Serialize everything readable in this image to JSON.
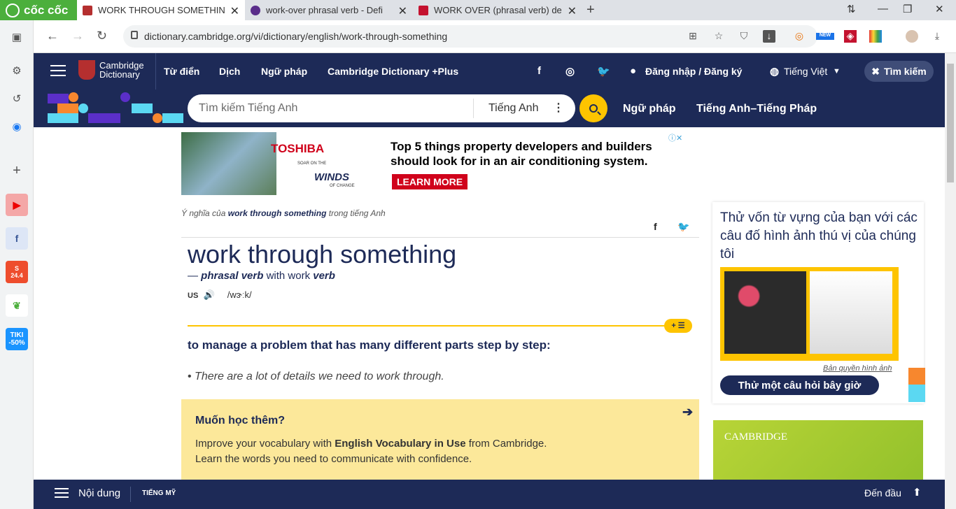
{
  "browser": {
    "brand": "cốc cốc",
    "tabs": [
      {
        "title": "WORK THROUGH SOMETHIN",
        "active": true
      },
      {
        "title": "work-over phrasal verb - Defi",
        "active": false
      },
      {
        "title": "WORK OVER (phrasal verb) de",
        "active": false
      }
    ],
    "url": "dictionary.cambridge.org/vi/dictionary/english/work-through-something",
    "new_badge": "NEW"
  },
  "sidebar": {
    "tiki_label": "TIKI",
    "tiki_discount": "-50%",
    "shopee_label": "24.4"
  },
  "site": {
    "logo_line1": "Cambridge",
    "logo_line2": "Dictionary",
    "nav": [
      "Từ điển",
      "Dịch",
      "Ngữ pháp",
      "Cambridge Dictionary +Plus"
    ],
    "login": "Đăng nhập / Đăng ký",
    "language": "Tiếng Việt",
    "search_button": "Tìm kiếm",
    "search_placeholder": "Tìm kiếm Tiếng Anh",
    "search_lang": "Tiếng Anh",
    "band_links": [
      "Ngữ pháp",
      "Tiếng Anh–Tiếng Pháp"
    ]
  },
  "ad": {
    "brand": "TOSHIBA",
    "tagline_small": "SOAR ON THE",
    "tagline_big": "WINDS",
    "tagline_sub": "OF CHANGE",
    "headline": "Top 5 things property developers and builders should look for in an air conditioning system.",
    "cta": "LEARN MORE"
  },
  "entry": {
    "crumb_pre": "Ý nghĩa của",
    "crumb_word": "work through something",
    "crumb_post": "trong tiếng Anh",
    "headword": "work through something",
    "pos_dash": "—",
    "pos": "phrasal verb",
    "pos_with": "with work",
    "pos_base": "verb",
    "region": "US",
    "ipa": "/wɝːk/",
    "plus_list": "+ ☰",
    "definition": "to manage a problem that has many different parts step by step:",
    "example": "There are a lot of details we need to work through.",
    "learn_more_heading": "Muốn học thêm?",
    "learn_more_text_pre": "Improve your vocabulary with",
    "learn_more_book": "English Vocabulary in Use",
    "learn_more_text_post": "from Cambridge.",
    "learn_more_line2": "Learn the words you need to communicate with confidence."
  },
  "quiz": {
    "title": "Thử vốn từ vựng của bạn với các câu đố hình ảnh thú vị của chúng tôi",
    "copyright": "Bản quyền hình ảnh",
    "button": "Thử một câu hỏi bây giờ"
  },
  "cup_ad": {
    "brand": "CAMBRIDGE"
  },
  "bottom": {
    "contents": "Nội dung",
    "region": "TIẾNG MỸ",
    "back_to_top": "Đến đầu"
  },
  "colors": {
    "navy": "#1d2a57",
    "gold": "#fec400",
    "tab_bg": "#dee1e6",
    "browser_green": "#4caf3c"
  }
}
